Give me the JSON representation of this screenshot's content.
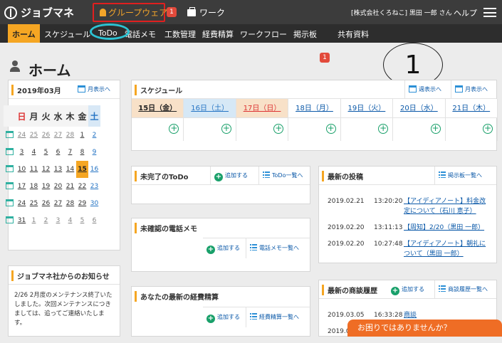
{
  "app": {
    "name": "ジョブマネ"
  },
  "topbar": {
    "groupware_label": "グループウェア",
    "groupware_badge": "1",
    "work_label": "ワーク",
    "user_info": "[株式会社くろねこ] 黒田 一郎 さん",
    "help_label": "ヘルプ"
  },
  "nav": {
    "items": [
      "ホーム",
      "スケジュール",
      "ToDo",
      "電話メモ",
      "工数管理",
      "経費精算",
      "ワークフロー",
      "掲示板",
      "共有資料"
    ],
    "bulletin_badge": "1"
  },
  "page": {
    "title": "ホーム"
  },
  "annotation": {
    "number": "1"
  },
  "colors": {
    "accent": "#f5a623",
    "topbar": "#3c3c3c",
    "highlight_box": "#e01f1f",
    "highlight_ring": "#2cc3d3",
    "help_button": "#ef6d25"
  },
  "calendar": {
    "month": "2019年03月",
    "month_view_label": "月表示へ",
    "weekday_headers": [
      "日",
      "月",
      "火",
      "水",
      "木",
      "金",
      "土"
    ],
    "weeks": [
      [
        "24",
        "25",
        "26",
        "27",
        "28",
        "1",
        "2"
      ],
      [
        "3",
        "4",
        "5",
        "6",
        "7",
        "8",
        "9"
      ],
      [
        "10",
        "11",
        "12",
        "13",
        "14",
        "15",
        "16"
      ],
      [
        "17",
        "18",
        "19",
        "20",
        "21",
        "22",
        "23"
      ],
      [
        "24",
        "25",
        "26",
        "27",
        "28",
        "29",
        "30"
      ],
      [
        "31",
        "1",
        "2",
        "3",
        "4",
        "5",
        "6"
      ]
    ],
    "today": "15"
  },
  "notice": {
    "title": "ジョブマネ社からのお知らせ",
    "body": "2/26 2月度のメンテナンス終了いたしました。次回メンテナンスにつきましては、追ってご連絡いたします。"
  },
  "schedule": {
    "title": "スケジュール",
    "week_view_label": "週表示へ",
    "month_view_label": "月表示へ",
    "days": [
      "15日（金）",
      "16日（土）",
      "17日（日）",
      "18日（月）",
      "19日（火）",
      "20日（水）",
      "21日（木）"
    ]
  },
  "todo": {
    "title": "未完了のToDo",
    "add_label": "追加する",
    "list_label": "ToDo一覧へ"
  },
  "phone_memo": {
    "title": "未確認の電話メモ",
    "add_label": "追加する",
    "list_label": "電話メモ一覧へ"
  },
  "expense": {
    "title": "あなたの最新の経費精算",
    "add_label": "追加する",
    "list_label": "経費精算一覧へ"
  },
  "posts": {
    "title": "最新の投稿",
    "list_label": "掲示板一覧へ",
    "items": [
      {
        "date": "2019.02.21",
        "time": "13:20:20",
        "text": "【アイディアノート】料金改定について（石川 恵子）"
      },
      {
        "date": "2019.02.20",
        "time": "13:11:13",
        "text": "【周知】2/20（黒田 一郎）"
      },
      {
        "date": "2019.02.20",
        "time": "10:27:48",
        "text": "【アイディアノート】朝礼について（黒田 一郎）"
      }
    ]
  },
  "negotiation": {
    "title": "最新の商談履歴",
    "add_label": "追加する",
    "list_label": "商談履歴一覧へ",
    "items": [
      {
        "date": "2019.03.05",
        "time": "16:33:28",
        "text": "商談"
      },
      {
        "date": "2019.0",
        "time": "",
        "text": ""
      }
    ]
  },
  "help_button": {
    "label": "お困りではありませんか？"
  }
}
